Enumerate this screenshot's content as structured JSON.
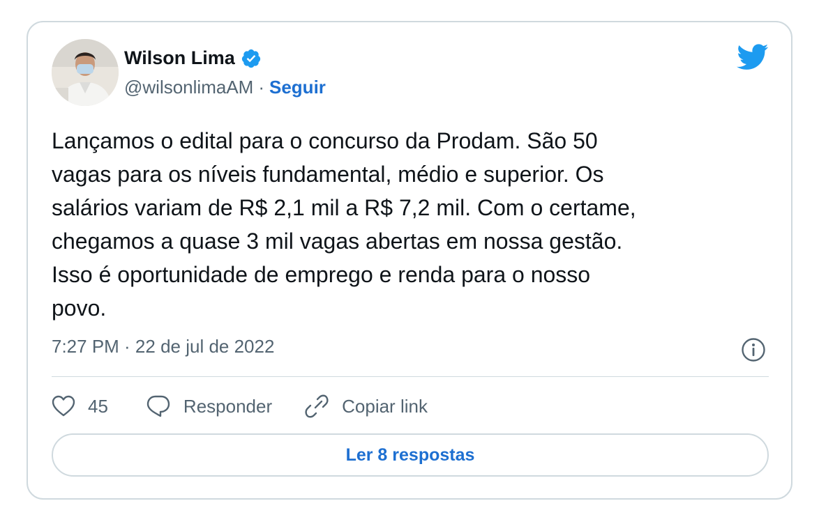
{
  "tweet": {
    "author_name": "Wilson Lima",
    "handle": "@wilsonlimaAM",
    "separator": "·",
    "follow_label": "Seguir",
    "text": "Lançamos o edital para o concurso da Prodam. São 50\nvagas para os níveis fundamental, médio e superior. Os\nsalários variam de R$ 2,1 mil a R$ 7,2 mil. Com o certame,\nchegamos a quase 3 mil vagas abertas em nossa gestão.\nIsso é oportunidade de emprego e renda para o nosso\npovo.",
    "timestamp": "7:27 PM · 22 de jul de 2022",
    "like_count": "45",
    "reply_label": "Responder",
    "copy_link_label": "Copiar link",
    "read_replies_label": "Ler 8 respostas"
  },
  "icons": {
    "brand": "twitter-bird-icon",
    "verified": "verified-badge-icon",
    "info": "info-icon",
    "like": "heart-icon",
    "reply": "speech-bubble-icon",
    "copy_link": "link-icon"
  },
  "colors": {
    "brand_blue": "#1d9bf0",
    "link_blue": "#1d6fd1",
    "text": "#0f1419",
    "secondary_text": "#536471",
    "border": "#cfd9de"
  }
}
